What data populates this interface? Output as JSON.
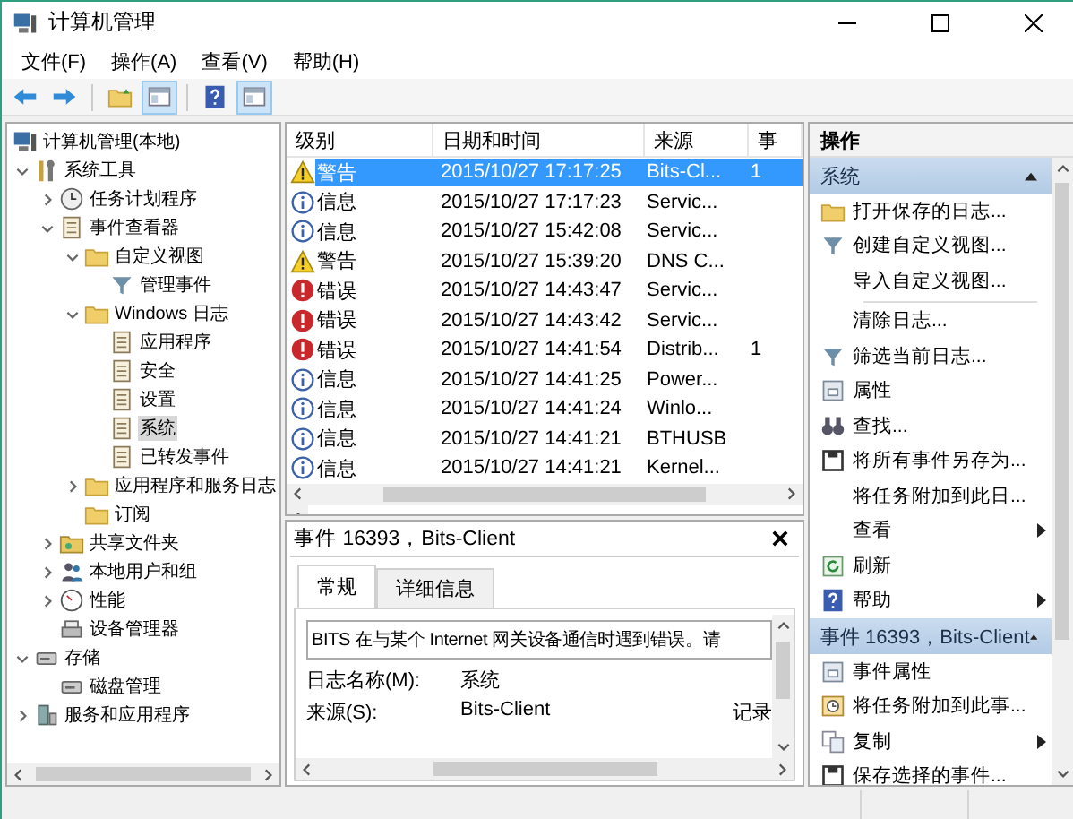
{
  "window": {
    "title": "计算机管理"
  },
  "menu": [
    "文件(F)",
    "操作(A)",
    "查看(V)",
    "帮助(H)"
  ],
  "toolbar": [
    {
      "pressed": false
    },
    {
      "pressed": false
    },
    {
      "pressed": false
    },
    {
      "pressed": true
    },
    {
      "pressed": false
    },
    {
      "pressed": true
    }
  ],
  "tree": [
    {
      "label": "计算机管理(本地)",
      "selected": false,
      "children": [
        {
          "label": "系统工具",
          "selected": false,
          "expanded": true,
          "children": [
            {
              "label": "任务计划程序",
              "selected": false,
              "expanded": false
            },
            {
              "label": "事件查看器",
              "selected": false,
              "expanded": true,
              "children": [
                {
                  "label": "自定义视图",
                  "selected": false,
                  "expanded": true,
                  "children": [
                    {
                      "label": "管理事件",
                      "selected": false
                    }
                  ]
                },
                {
                  "label": "Windows 日志",
                  "selected": false,
                  "expanded": true,
                  "children": [
                    {
                      "label": "应用程序",
                      "selected": false
                    },
                    {
                      "label": "安全",
                      "selected": false
                    },
                    {
                      "label": "设置",
                      "selected": false
                    },
                    {
                      "label": "系统",
                      "selected": true
                    },
                    {
                      "label": "已转发事件",
                      "selected": false
                    }
                  ]
                },
                {
                  "label": "应用程序和服务日志",
                  "selected": false,
                  "expanded": false
                },
                {
                  "label": "订阅",
                  "selected": false
                }
              ]
            },
            {
              "label": "共享文件夹",
              "selected": false,
              "expanded": false
            },
            {
              "label": "本地用户和组",
              "selected": false,
              "expanded": false
            },
            {
              "label": "性能",
              "selected": false,
              "expanded": false
            },
            {
              "label": "设备管理器",
              "selected": false
            }
          ]
        },
        {
          "label": "存储",
          "selected": false,
          "expanded": true,
          "children": [
            {
              "label": "磁盘管理",
              "selected": false
            }
          ]
        },
        {
          "label": "服务和应用程序",
          "selected": false,
          "expanded": false
        }
      ]
    }
  ],
  "events": {
    "columns": [
      "级别",
      "日期和时间",
      "来源",
      "事"
    ],
    "rows": [
      {
        "kind": "warning",
        "level": "警告",
        "datetime": "2015/10/27 17:17:25",
        "source": "Bits-Cl...",
        "column_4": "1",
        "selected": true
      },
      {
        "kind": "info",
        "level": "信息",
        "datetime": "2015/10/27 17:17:23",
        "source": "Servic...",
        "selected": false
      },
      {
        "kind": "info",
        "level": "信息",
        "datetime": "2015/10/27 15:42:08",
        "source": "Servic...",
        "selected": false
      },
      {
        "kind": "warning",
        "level": "警告",
        "datetime": "2015/10/27 15:39:20",
        "source": "DNS C...",
        "selected": false
      },
      {
        "kind": "error",
        "level": "错误",
        "datetime": "2015/10/27 14:43:47",
        "source": "Servic...",
        "selected": false
      },
      {
        "kind": "error",
        "level": "错误",
        "datetime": "2015/10/27 14:43:42",
        "source": "Servic...",
        "selected": false
      },
      {
        "kind": "error",
        "level": "错误",
        "datetime": "2015/10/27 14:41:54",
        "source": "Distrib...",
        "column_4": "1",
        "selected": false
      },
      {
        "kind": "info",
        "level": "信息",
        "datetime": "2015/10/27 14:41:25",
        "source": "Power...",
        "selected": false
      },
      {
        "kind": "info",
        "level": "信息",
        "datetime": "2015/10/27 14:41:24",
        "source": "Winlo...",
        "selected": false
      },
      {
        "kind": "info",
        "level": "信息",
        "datetime": "2015/10/27 14:41:21",
        "source": "BTHUSB",
        "selected": false
      },
      {
        "kind": "info",
        "level": "信息",
        "datetime": "2015/10/27 14:41:21",
        "source": "Kernel...",
        "selected": false
      }
    ]
  },
  "detail": {
    "title": "事件 16393，Bits-Client",
    "tabs": [
      {
        "label": "常规",
        "selected": true
      },
      {
        "label": "详细信息",
        "selected": false
      }
    ],
    "message": "BITS 在与某个 Internet 网关设备通信时遇到错误。请",
    "fields": [
      {
        "label": "日志名称(M):",
        "value": "系统"
      },
      {
        "label": "来源(S):",
        "value": "Bits-Client",
        "column_3": "记录"
      }
    ]
  },
  "actions": {
    "title": "操作",
    "sections": [
      {
        "title": "系统",
        "items": [
          {
            "kind": "action",
            "label": "打开保存的日志...",
            "submenu": false
          },
          {
            "kind": "action",
            "label": "创建自定义视图...",
            "submenu": false
          },
          {
            "kind": "action",
            "label": "导入自定义视图...",
            "submenu": false
          },
          {
            "kind": "separator"
          },
          {
            "kind": "action",
            "label": "清除日志...",
            "submenu": false
          },
          {
            "kind": "action",
            "label": "筛选当前日志...",
            "submenu": false
          },
          {
            "kind": "action",
            "label": "属性",
            "submenu": false
          },
          {
            "kind": "action",
            "label": "查找...",
            "submenu": false
          },
          {
            "kind": "action",
            "label": "将所有事件另存为...",
            "submenu": false
          },
          {
            "kind": "action",
            "label": "将任务附加到此日...",
            "submenu": false
          },
          {
            "kind": "action",
            "label": "查看",
            "submenu": true
          },
          {
            "kind": "action",
            "label": "刷新",
            "submenu": false
          },
          {
            "kind": "action",
            "label": "帮助",
            "submenu": true
          }
        ]
      },
      {
        "title": "事件 16393，Bits-Client",
        "items": [
          {
            "kind": "action",
            "label": "事件属性",
            "submenu": false
          },
          {
            "kind": "action",
            "label": "将任务附加到此事...",
            "submenu": false
          },
          {
            "kind": "action",
            "label": "复制",
            "submenu": true
          },
          {
            "kind": "action",
            "label": "保存选择的事件...",
            "submenu": false
          }
        ]
      }
    ]
  }
}
